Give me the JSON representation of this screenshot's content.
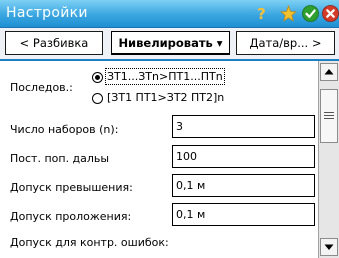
{
  "window": {
    "title": "Настройки",
    "icons": [
      "help-icon",
      "star-icon",
      "ok-icon",
      "close-icon"
    ]
  },
  "tabs": {
    "prev_label": "< Разбивка",
    "active_label": "Нивелировать ▾",
    "next_label": "Дата/вр... >"
  },
  "form": {
    "sequence": {
      "label": "Последов.:",
      "option1": "ЗТ1...ЗTn>ПТ1...ПТn",
      "option2": "[ЗТ1 ПТ1>ЗТ2 ПТ2]n",
      "selected": 1
    },
    "sets": {
      "label": "Число наборов (n):",
      "value": "3"
    },
    "const_dist": {
      "label": "Пост. поп. дальы",
      "value": "100"
    },
    "tolerance_rise": {
      "label": "Допуск превышения:",
      "value": "0,1 м"
    },
    "tolerance_layout": {
      "label": "Допуск проложения:",
      "value": "0,1 м"
    },
    "tolerance_control": {
      "label": "Допуск для контр. ошибок:"
    }
  },
  "colors": {
    "title_bar": "#3aa6e1",
    "tab_strip_border": "#1f7fc4",
    "ok_icon": "#2e9e2e",
    "close_icon": "#d23a2a",
    "star_icon": "#f2c230"
  }
}
